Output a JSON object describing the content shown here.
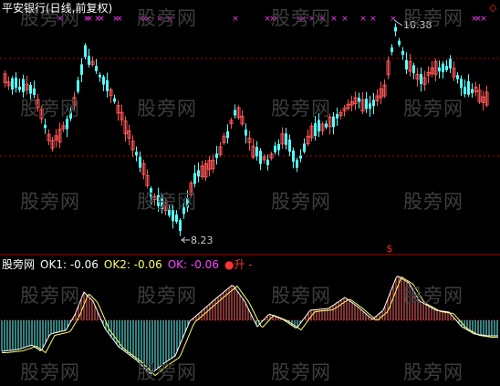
{
  "main_panel": {
    "title": "平安银行(日线,前复权)",
    "high_label": "10.38",
    "low_label": "8.23",
    "signal_mark": "$",
    "marker_glyph": "×",
    "up_color": "#ff5555",
    "down_color": "#54ffff",
    "grid_color": "#b30000",
    "marker_color": "#ff33ff"
  },
  "sub_panel": {
    "name": "股旁网",
    "items": [
      {
        "label": "OK1: -0.06",
        "color": "#ffffff"
      },
      {
        "label": "OK2: -0.06",
        "color": "#ffff66"
      },
      {
        "label": "OK: -0.06",
        "color": "#ff44ff"
      },
      {
        "label": "●升 -",
        "color": "#ff3333"
      }
    ],
    "pos_bar_color": "#ff6666",
    "neg_bar_color": "#66ffff",
    "line1_color": "#ffffff",
    "line2_color": "#ffff66"
  },
  "watermark": "股旁网",
  "corner_icon": "diamond-icon",
  "corner_color": "#ff2222"
}
